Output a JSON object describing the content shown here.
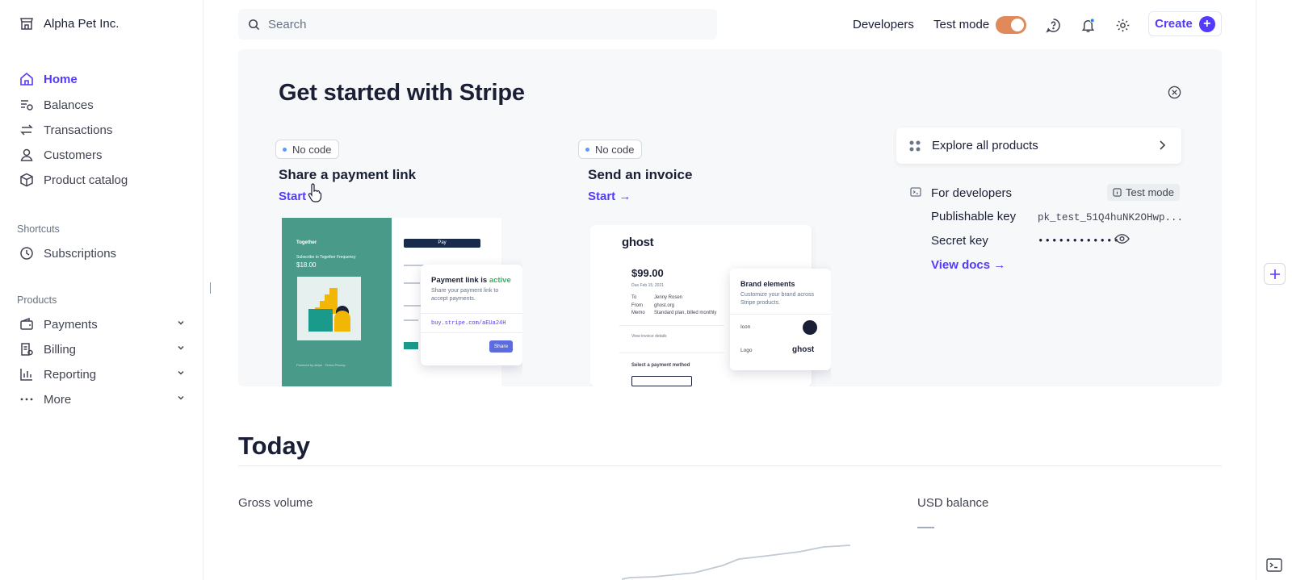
{
  "sidebar": {
    "account_name": "Alpha Pet Inc.",
    "items": [
      {
        "label": "Home",
        "icon": "home-icon",
        "active": true
      },
      {
        "label": "Balances",
        "icon": "balances-icon"
      },
      {
        "label": "Transactions",
        "icon": "transactions-icon"
      },
      {
        "label": "Customers",
        "icon": "customers-icon"
      },
      {
        "label": "Product catalog",
        "icon": "product-catalog-icon"
      }
    ],
    "shortcuts_label": "Shortcuts",
    "shortcuts": [
      {
        "label": "Subscriptions",
        "icon": "clock-icon"
      }
    ],
    "products_label": "Products",
    "products": [
      {
        "label": "Payments",
        "icon": "wallet-icon"
      },
      {
        "label": "Billing",
        "icon": "billing-icon"
      },
      {
        "label": "Reporting",
        "icon": "bar-chart-icon"
      },
      {
        "label": "More",
        "icon": "more-dots-icon"
      }
    ]
  },
  "header": {
    "search_placeholder": "Search",
    "developers_label": "Developers",
    "test_mode_label": "Test mode",
    "test_mode_on": true,
    "create_label": "Create"
  },
  "get_started": {
    "title": "Get started with Stripe",
    "cards": [
      {
        "badge": "No code",
        "title": "Share a payment link",
        "link": "Start"
      },
      {
        "badge": "No code",
        "title": "Send an invoice",
        "link": "Start →"
      }
    ],
    "payment_link_illustration": {
      "brand": "Together",
      "subtitle": "Subscribe to Together Frequency",
      "price": "$18.00",
      "pay_button": " Pay",
      "popup_title": "Payment link is",
      "popup_status": "active",
      "popup_text": "Share your payment link to accept payments.",
      "popup_url": "buy.stripe.com/aEUa24H",
      "popup_button": "Share"
    },
    "invoice_illustration": {
      "logo": "ghost",
      "amount": "$99.00",
      "due": "Due Feb 15, 2021",
      "to_label": "To",
      "to_value": "Jenny Rosen",
      "from_label": "From",
      "from_value": "ghost.org",
      "memo_label": "Memo",
      "memo_value": "Standard plan, billed monthly",
      "details_link": "View invoice details",
      "payment_method": "Select a payment method",
      "brand_title": "Brand elements",
      "brand_text": "Customize your brand across Stripe products.",
      "icon_label": "Icon",
      "logo_label": "Logo"
    },
    "explore_label": "Explore all products",
    "developers": {
      "title": "For developers",
      "badge": "Test mode",
      "publishable_label": "Publishable key",
      "publishable_value": "pk_test_51Q4huNK2OHwp...",
      "secret_label": "Secret key",
      "secret_value": "••••••••••••",
      "docs_link": "View docs →"
    }
  },
  "today": {
    "title": "Today",
    "gross_volume_label": "Gross volume",
    "usd_balance_label": "USD balance"
  },
  "colors": {
    "accent": "#533afd",
    "toggle": "#e08a5c",
    "panel_bg": "#f6f8fa",
    "illustration_green": "#4a9a8a"
  }
}
